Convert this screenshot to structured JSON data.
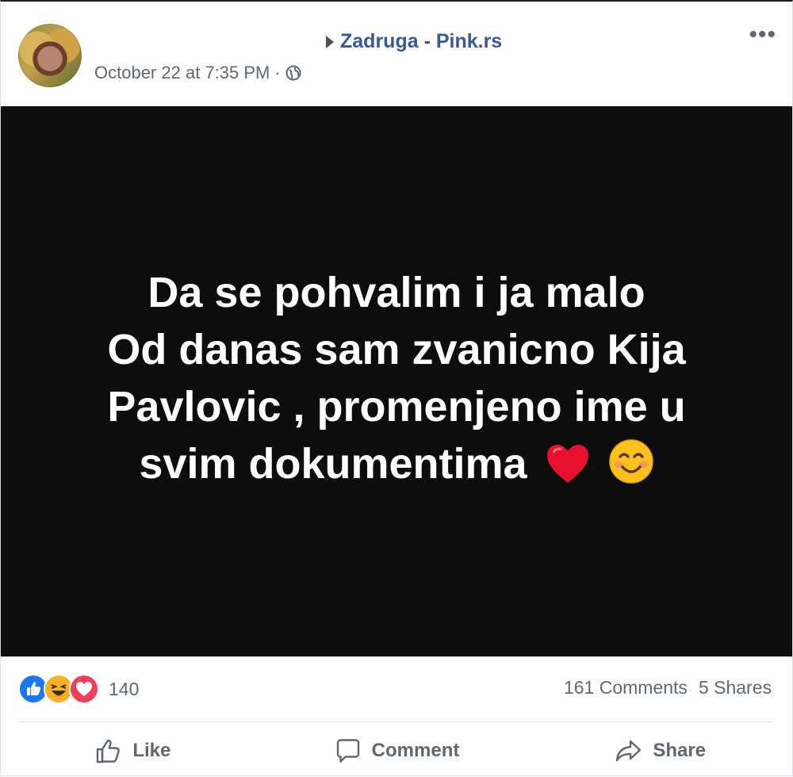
{
  "post": {
    "page_name": "Zadruga - Pink.rs",
    "timestamp": "October 22 at 7:35 PM",
    "separator": "·",
    "privacy_icon": "globe-icon",
    "more_label": "•••",
    "image_text_lines": [
      "Da se pohvalim i ja malo",
      "Od danas sam zvanicno Kija",
      "Pavlovic , promenjeno ime u",
      "svim dokumentima"
    ],
    "image_text_emojis": [
      "red-heart-emoji",
      "smiling-face-emoji"
    ]
  },
  "stats": {
    "reactions": [
      "like",
      "haha",
      "love"
    ],
    "reaction_count": "140",
    "comments": "161 Comments",
    "shares": "5 Shares"
  },
  "actions": {
    "like": "Like",
    "comment": "Comment",
    "share": "Share"
  },
  "colors": {
    "link": "#385898",
    "muted": "#606770",
    "image_bg": "#0d0d0d",
    "like_blue": "#1877f2",
    "love_red": "#f33e58",
    "haha_yellow": "#f7b125"
  }
}
